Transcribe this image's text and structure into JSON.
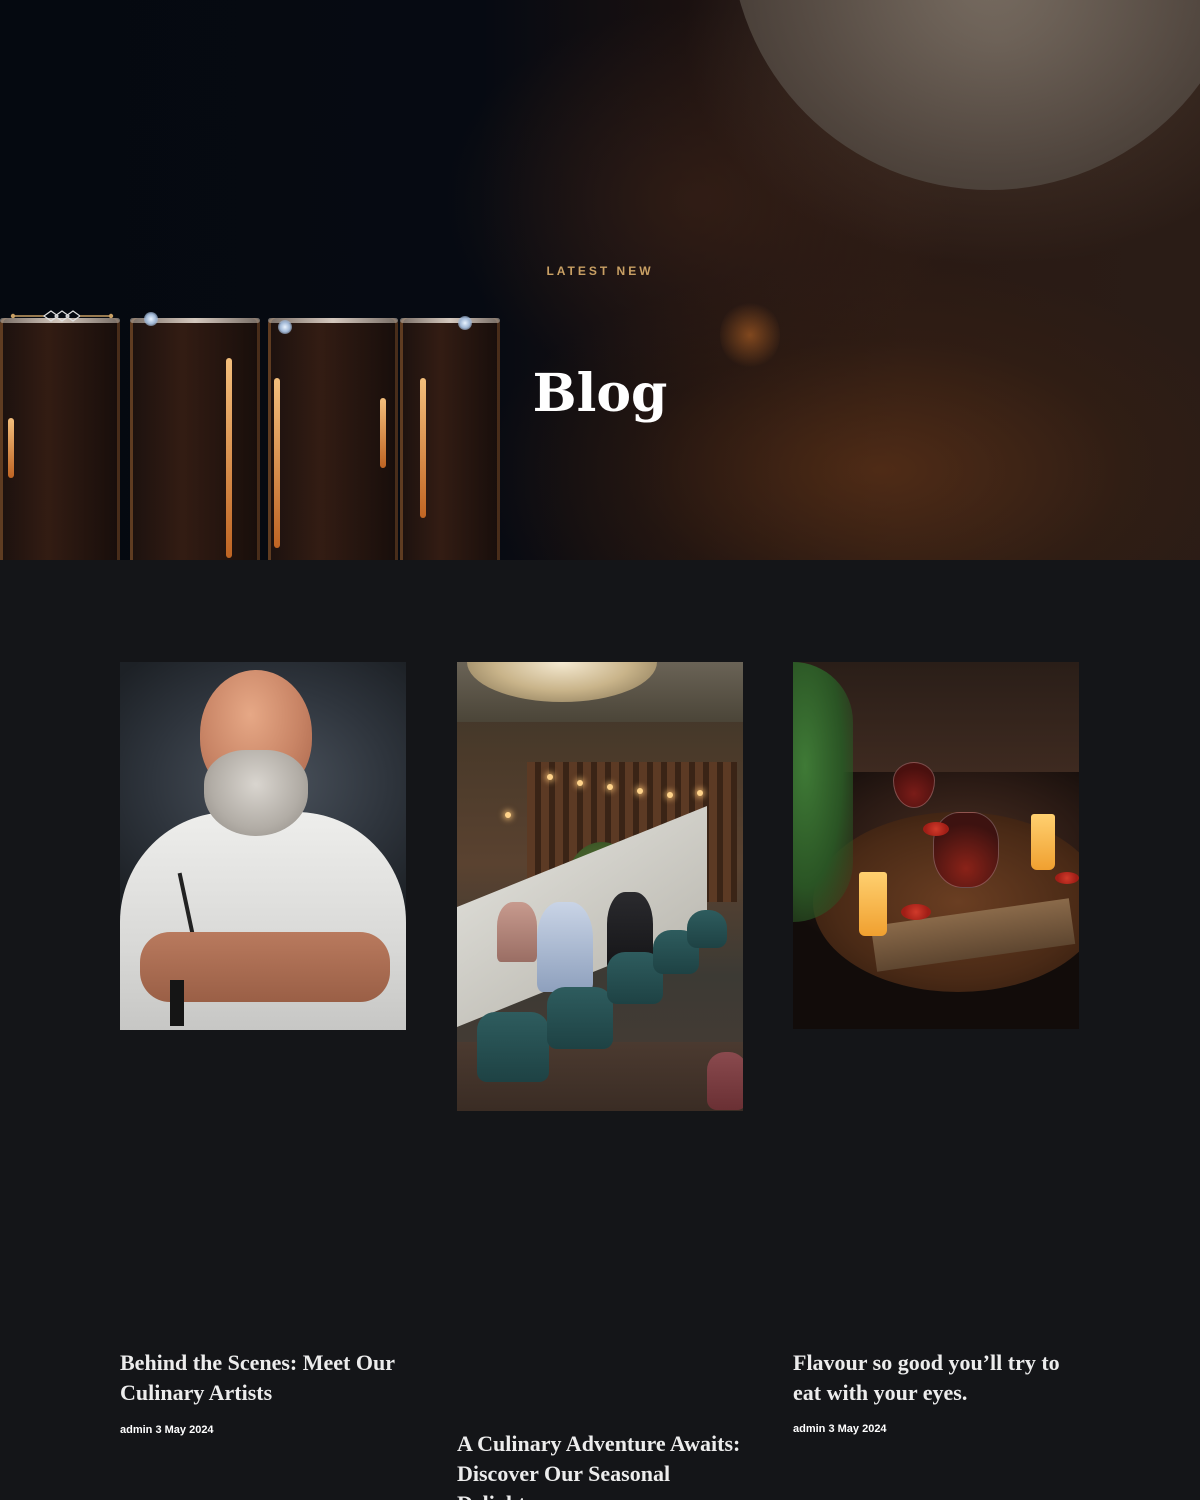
{
  "hero": {
    "eyebrow": "LATEST NEW",
    "title": "Blog"
  },
  "posts": [
    {
      "title": "Behind the Scenes: Meet Our Culinary Artists",
      "meta": "admin 3 May 2024"
    },
    {
      "title": "A Culinary Adventure Awaits: Discover Our Seasonal Delights",
      "meta": ""
    },
    {
      "title": "Flavour so good you’ll try to eat with your eyes.",
      "meta": "admin 3 May 2024"
    }
  ],
  "colors": {
    "background": "#141518",
    "accent_gold": "#c9a064",
    "title_text": "#ececec"
  }
}
